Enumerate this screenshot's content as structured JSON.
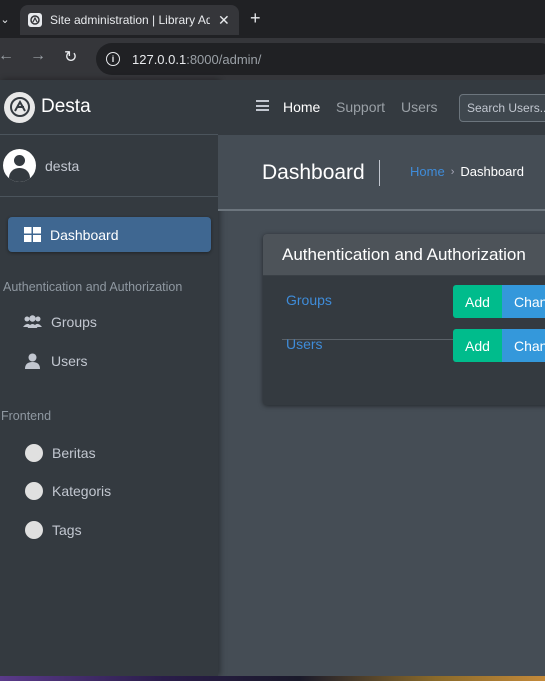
{
  "browser": {
    "tab_title": "Site administration | Library Admin",
    "url_host": "127.0.0.1",
    "url_path": ":8000/admin/"
  },
  "sidebar": {
    "brand": "Desta",
    "user_name": "desta",
    "active_item": "Dashboard",
    "sections": [
      {
        "header": "Authentication and Authorization",
        "items": [
          "Groups",
          "Users"
        ]
      },
      {
        "header": "Frontend",
        "items": [
          "Beritas",
          "Kategoris",
          "Tags"
        ]
      }
    ]
  },
  "topnav": {
    "links": [
      "Home",
      "Support",
      "Users"
    ],
    "search_placeholder": "Search Users..."
  },
  "content": {
    "page_title": "Dashboard",
    "breadcrumb": [
      "Home",
      "Dashboard"
    ],
    "card_title": "Authentication and Authorization",
    "rows": [
      {
        "label": "Groups",
        "add": "Add",
        "change": "Change"
      },
      {
        "label": "Users",
        "add": "Add",
        "change": "Change"
      }
    ]
  },
  "colors": {
    "sidebar_bg": "#343a40",
    "active_item": "#3f6791",
    "link": "#3f8cd9",
    "add_button": "#00bc8c",
    "change_button": "#3498db"
  }
}
